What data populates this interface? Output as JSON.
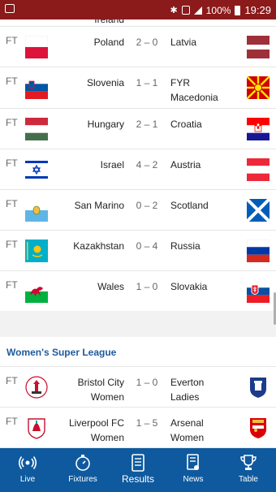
{
  "status": {
    "battery": "100%",
    "time": "19:29"
  },
  "partial_row": {
    "home": "Ireland"
  },
  "matches": [
    {
      "status": "FT",
      "home": "Poland",
      "score": "2 – 0",
      "away": "Latvia"
    },
    {
      "status": "FT",
      "home": "Slovenia",
      "score": "1 – 1",
      "away": "FYR Macedonia"
    },
    {
      "status": "FT",
      "home": "Hungary",
      "score": "2 – 1",
      "away": "Croatia"
    },
    {
      "status": "FT",
      "home": "Israel",
      "score": "4 – 2",
      "away": "Austria"
    },
    {
      "status": "FT",
      "home": "San Marino",
      "score": "0 – 2",
      "away": "Scotland"
    },
    {
      "status": "FT",
      "home": "Kazakhstan",
      "score": "0 – 4",
      "away": "Russia"
    },
    {
      "status": "FT",
      "home": "Wales",
      "score": "1 – 0",
      "away": "Slovakia"
    }
  ],
  "section2": {
    "title": "Women's Super League",
    "matches": [
      {
        "status": "FT",
        "home": "Bristol City Women",
        "score": "1 – 0",
        "away": "Everton Ladies"
      },
      {
        "status": "FT",
        "home": "Liverpool FC Women",
        "score": "1 – 5",
        "away": "Arsenal Women"
      }
    ]
  },
  "nav": {
    "live": "Live",
    "fixtures": "Fixtures",
    "results": "Results",
    "news": "News",
    "table": "Table"
  },
  "colors": {
    "status_bar": "#8b1a1a",
    "nav_bar": "#0f5a9e",
    "section_title": "#1e5a9c"
  }
}
